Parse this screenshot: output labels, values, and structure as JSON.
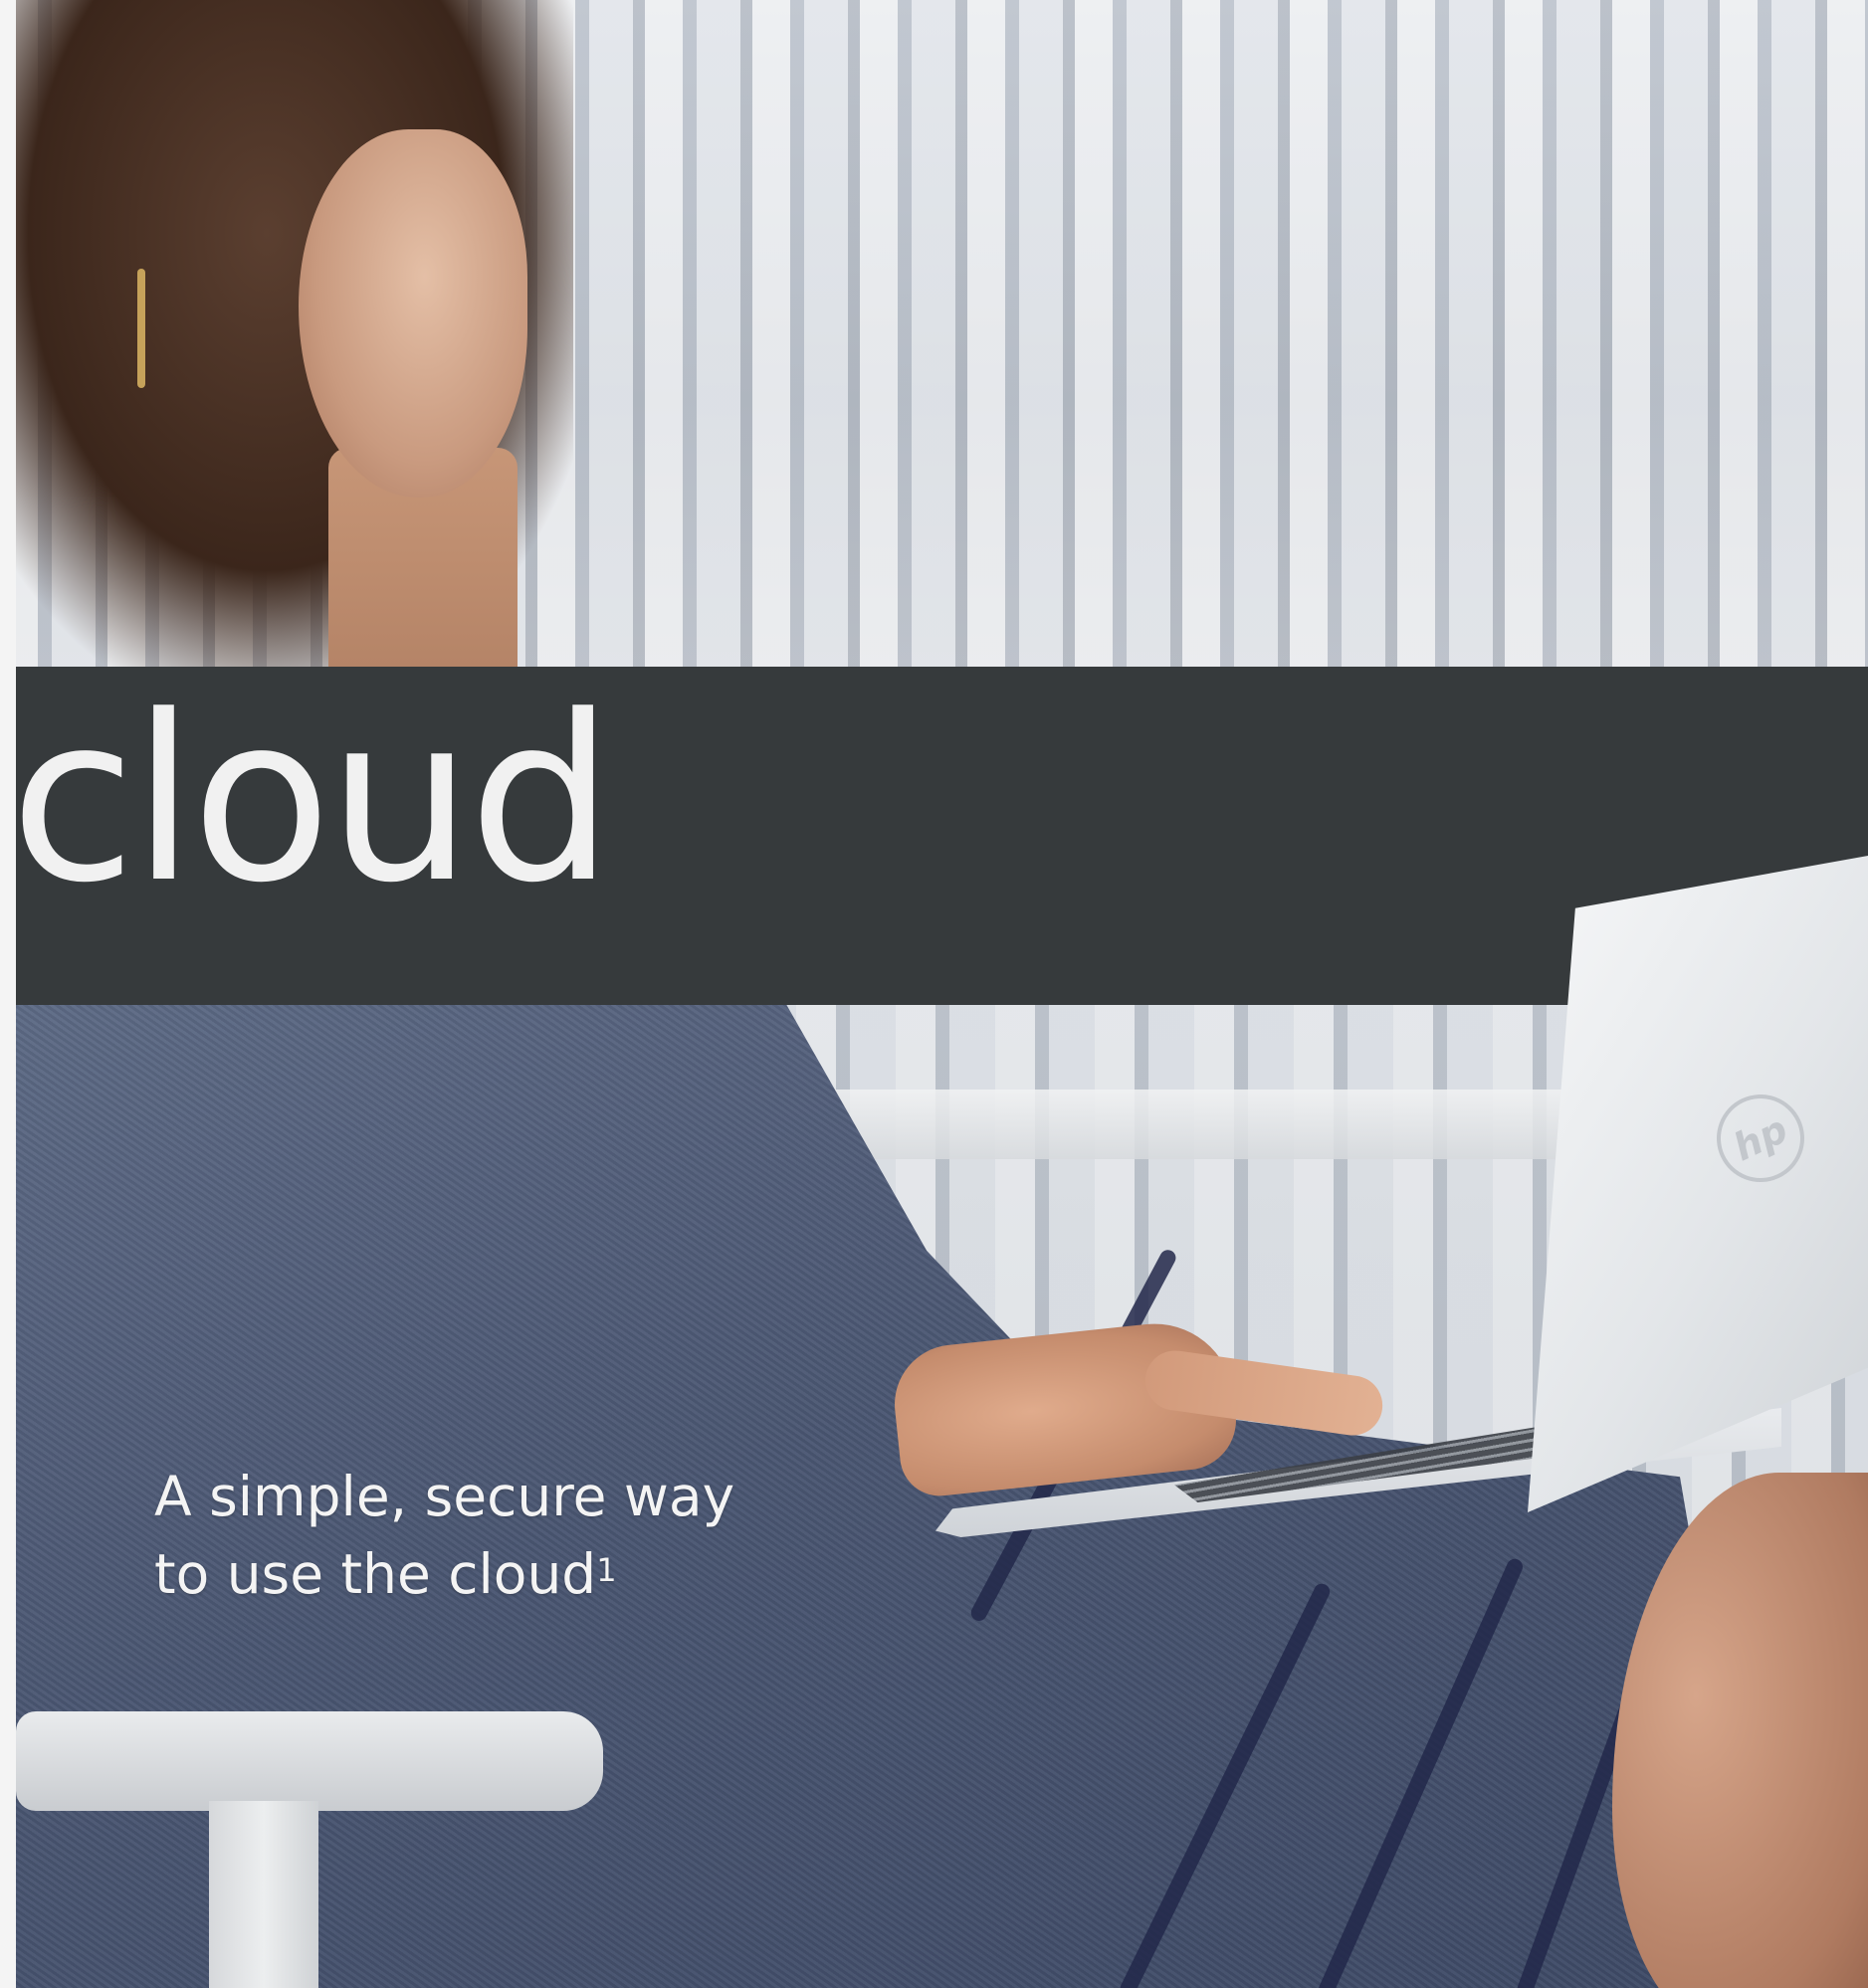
{
  "banner": {
    "title": "cloud"
  },
  "tagline": {
    "line1": "A simple, secure way",
    "line2": "to use the cloud",
    "footnote": "1"
  },
  "laptop": {
    "logo": "hp"
  },
  "colors": {
    "band": "#363a3c",
    "text": "#f1f1f1"
  }
}
